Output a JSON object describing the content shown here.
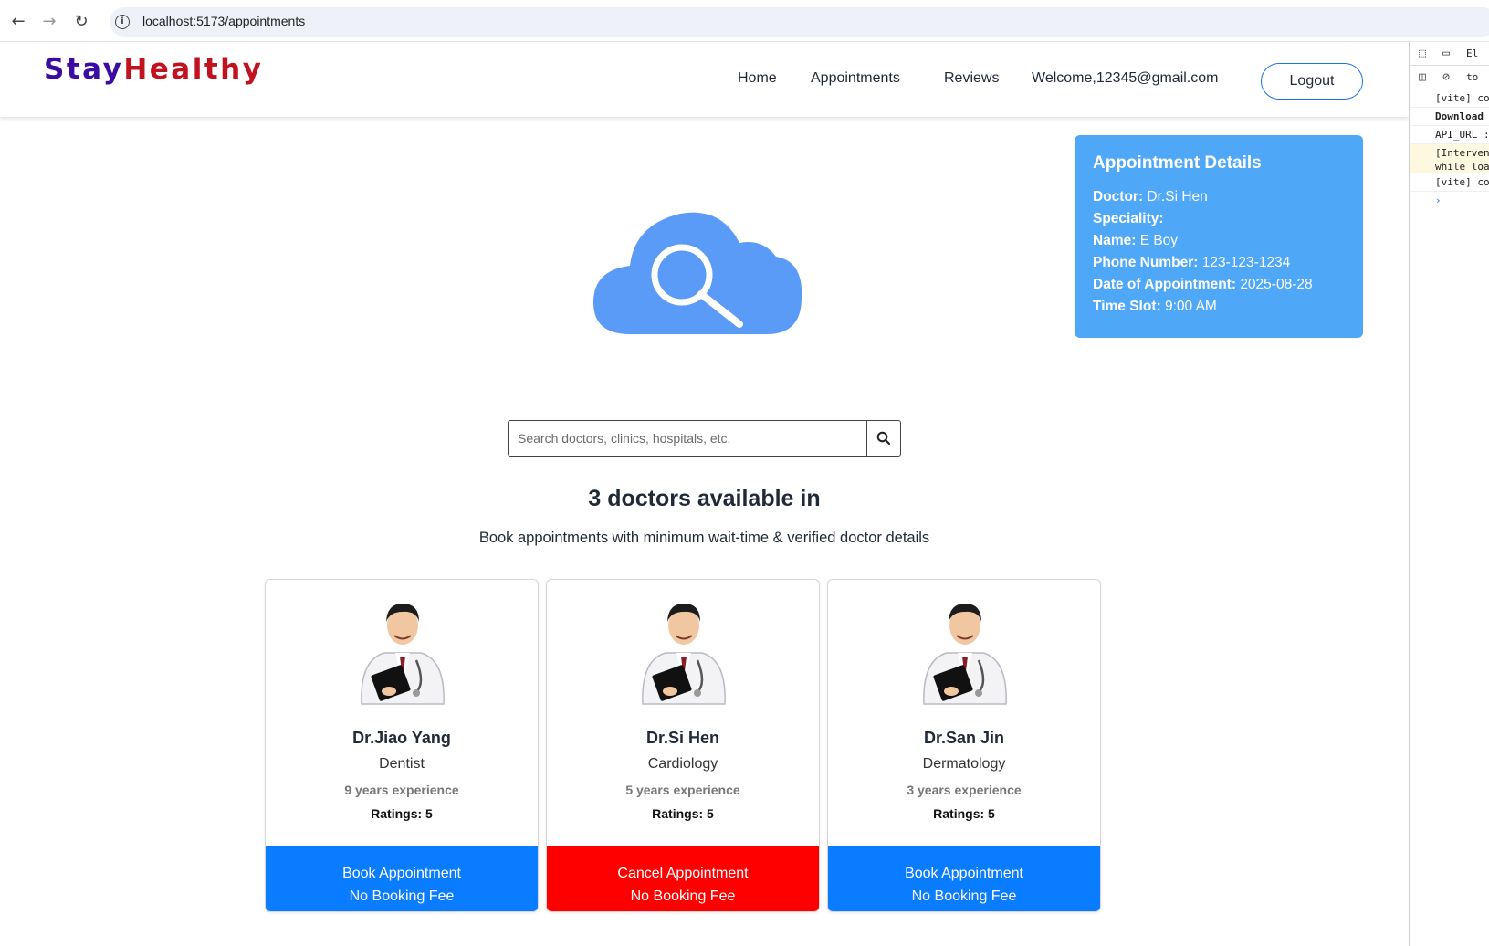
{
  "browser": {
    "url": "localhost:5173/appointments",
    "back_icon": "arrow-left-icon",
    "forward_icon": "arrow-right-icon",
    "reload_icon": "reload-icon"
  },
  "navbar": {
    "brand_part1": "Stay",
    "brand_part2": "Healthy",
    "links": [
      "Home",
      "Appointments",
      "Reviews"
    ],
    "welcome": "Welcome,12345@gmail.com",
    "logout": "Logout"
  },
  "appointment": {
    "title": "Appointment Details",
    "doctor_label": "Doctor:",
    "doctor_value": "Dr.Si Hen",
    "speciality_label": "Speciality:",
    "speciality_value": "",
    "name_label": "Name:",
    "name_value": "E Boy",
    "phone_label": "Phone Number:",
    "phone_value": "123-123-1234",
    "date_label": "Date of Appointment:",
    "date_value": "2025-08-28",
    "slot_label": "Time Slot:",
    "slot_value": "9:00 AM"
  },
  "search": {
    "placeholder": "Search doctors, clinics, hospitals, etc."
  },
  "results": {
    "heading": "3 doctors available in",
    "subheading": "Book appointments with minimum wait-time & verified doctor details"
  },
  "doctors": [
    {
      "name": "Dr.Jiao Yang",
      "speciality": "Dentist",
      "experience": "9 years experience",
      "ratings": "Ratings: 5",
      "action": "Book Appointment",
      "fee": "No Booking Fee"
    },
    {
      "name": "Dr.Si Hen",
      "speciality": "Cardiology",
      "experience": "5 years experience",
      "ratings": "Ratings: 5",
      "action": "Cancel Appointment",
      "fee": "No Booking Fee"
    },
    {
      "name": "Dr.San Jin",
      "speciality": "Dermatology",
      "experience": "3 years experience",
      "ratings": "Ratings: 5",
      "action": "Book Appointment",
      "fee": "No Booking Fee"
    }
  ],
  "devtools": {
    "tab": "El",
    "filter": "to",
    "lines": [
      "[vite] con",
      "Download",
      "API_URL :",
      "[Intervent",
      "while load",
      "[vite] con"
    ]
  },
  "colors": {
    "brand_primary": "#3a0ca3",
    "brand_secondary": "#c1121f",
    "card_blue": "#4fa7f8",
    "book_button": "#0a7cff",
    "cancel_button": "#ff0000"
  }
}
